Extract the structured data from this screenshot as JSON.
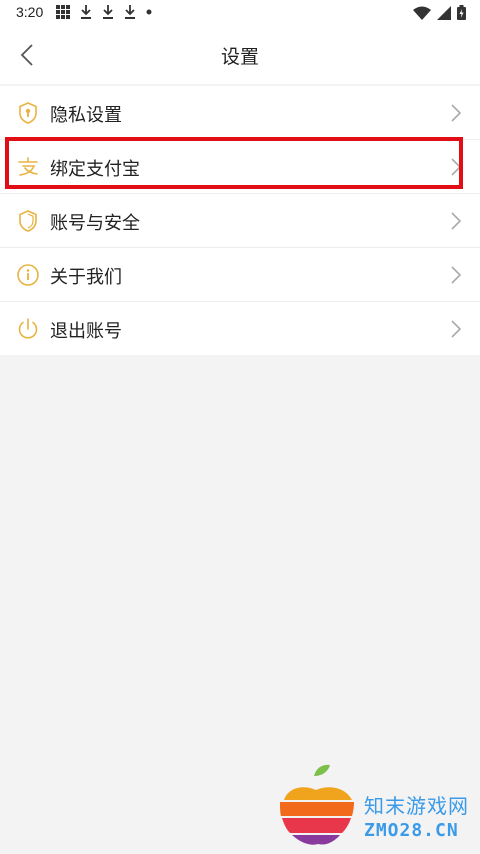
{
  "status_bar": {
    "time": "3:20"
  },
  "header": {
    "title": "设置"
  },
  "settings": [
    {
      "label": "隐私设置",
      "icon": "privacy-shield-icon"
    },
    {
      "label": "绑定支付宝",
      "icon": "alipay-icon",
      "highlighted": true
    },
    {
      "label": "账号与安全",
      "icon": "shield-icon"
    },
    {
      "label": "关于我们",
      "icon": "info-icon"
    },
    {
      "label": "退出账号",
      "icon": "power-icon"
    }
  ],
  "watermark": {
    "title": "知末游戏网",
    "url": "ZMO28.CN"
  },
  "colors": {
    "accent": "#e8b340",
    "highlight": "#e10d17",
    "watermark": "#3b9be8"
  }
}
